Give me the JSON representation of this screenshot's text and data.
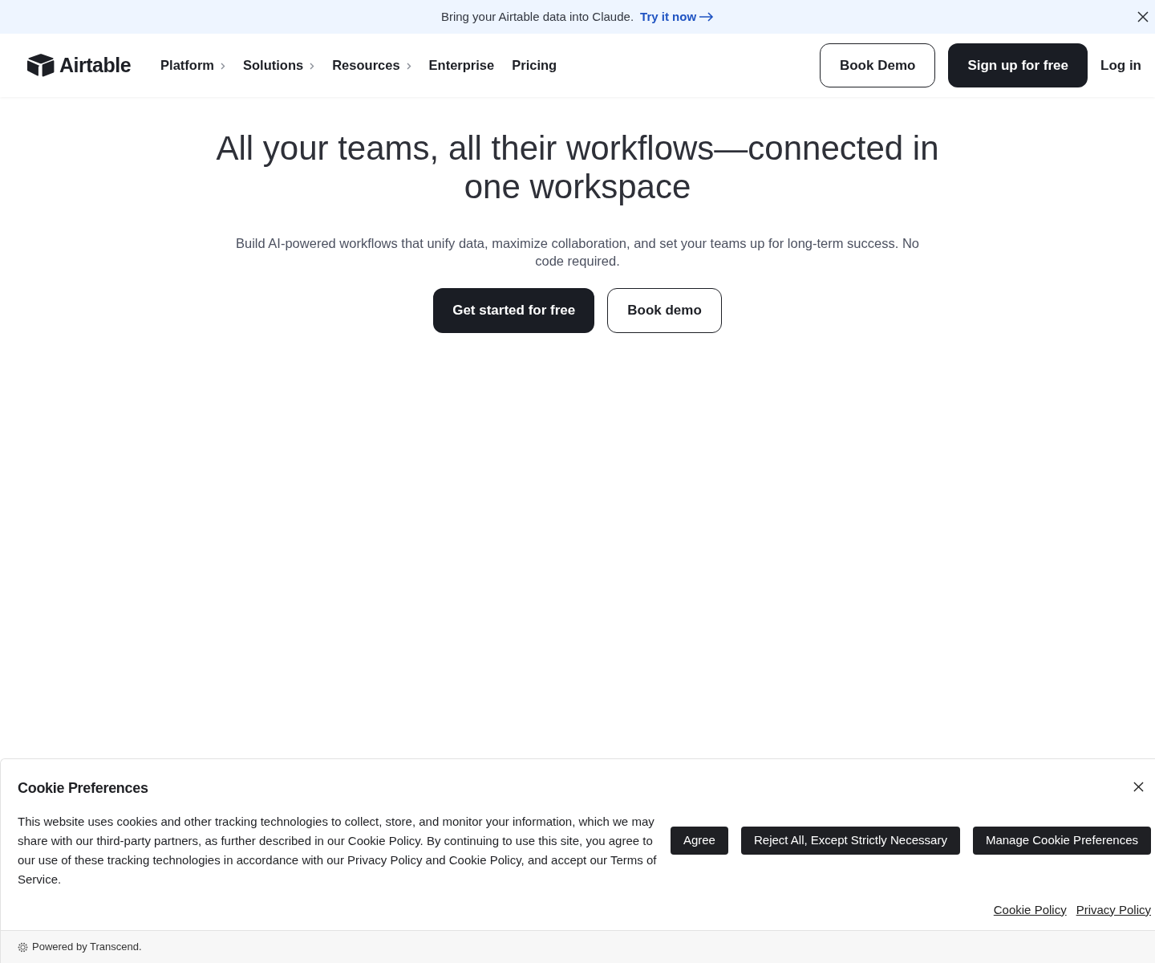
{
  "announcement": {
    "text": "Bring your Airtable data into Claude.",
    "link": "Try it now"
  },
  "nav": {
    "logo": "Airtable",
    "items": [
      {
        "label": "Platform",
        "submenu": true
      },
      {
        "label": "Solutions",
        "submenu": true
      },
      {
        "label": "Resources",
        "submenu": true
      },
      {
        "label": "Enterprise",
        "submenu": false
      },
      {
        "label": "Pricing",
        "submenu": false
      }
    ],
    "actions": [
      {
        "label": "Book Demo",
        "kind": "outline"
      },
      {
        "label": "Sign up for free",
        "kind": "solid"
      },
      {
        "label": "Log in",
        "kind": "plain"
      }
    ]
  },
  "hero": {
    "title": "All your teams, all their workflows—connected in one workspace",
    "subtitle": "Build AI-powered workflows that unify data, maximize collaboration, and set your teams up for long-term success. No code required.",
    "buttons": [
      {
        "label": "Get started for free",
        "kind": "solid"
      },
      {
        "label": "Book demo",
        "kind": "outline"
      }
    ]
  },
  "cookie_banner": {
    "title": "Cookie Preferences",
    "text": "This website uses cookies and other tracking technologies to collect, store, and monitor your information, which we may share with our third-party partners, as further described in our Cookie Policy. By continuing to use this site, you agree to our use of these tracking technologies in accordance with our Privacy Policy and Cookie Policy, and accept our Terms of Service.",
    "buttons": [
      "Agree",
      "Reject All, Except Strictly Necessary",
      "Manage Cookie Preferences"
    ],
    "links": [
      "Cookie Policy",
      "Privacy Policy"
    ],
    "footer": "Powered by Transcend."
  }
}
